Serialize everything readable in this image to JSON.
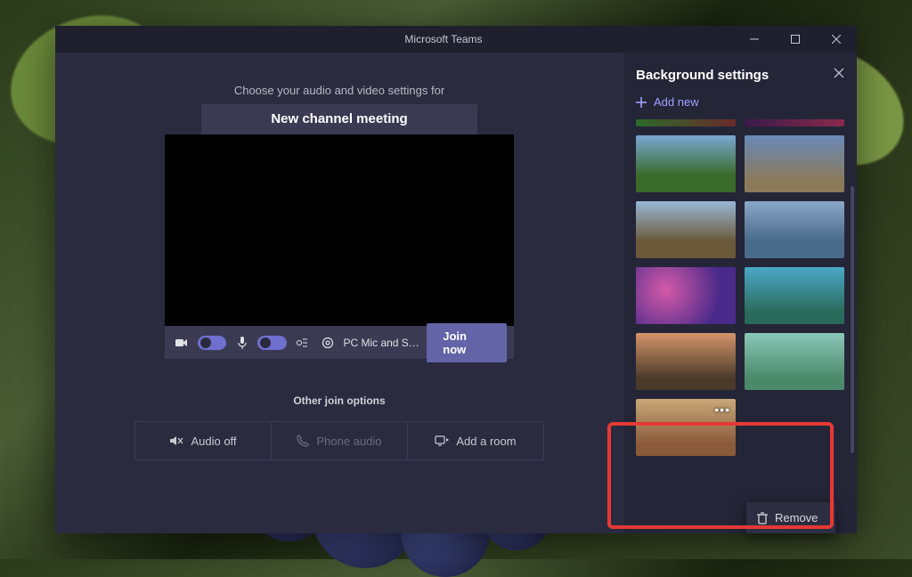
{
  "window": {
    "title": "Microsoft Teams"
  },
  "main": {
    "prompt": "Choose your audio and video settings for",
    "meeting_title": "New channel meeting",
    "device_label": "PC Mic and Sp…",
    "join_label": "Join now",
    "other_label": "Other join options",
    "options": {
      "audio_off": "Audio off",
      "phone_audio": "Phone audio",
      "add_room": "Add a room"
    }
  },
  "panel": {
    "title": "Background settings",
    "add_new": "Add new",
    "context_remove": "Remove"
  }
}
